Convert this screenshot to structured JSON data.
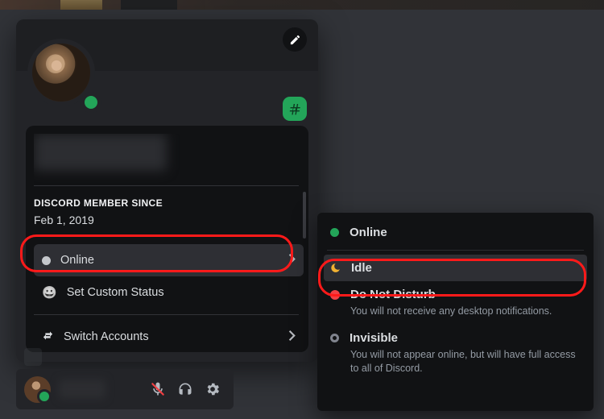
{
  "colors": {
    "accent": "#23a559",
    "danger": "#f23f43",
    "idle": "#f0b132",
    "bg_card": "#232428",
    "bg_panel": "#111214"
  },
  "profile": {
    "member_since_label": "DISCORD MEMBER SINCE",
    "member_since_value": "Feb 1, 2019"
  },
  "menu": {
    "online_label": "Online",
    "set_custom_status_label": "Set Custom Status",
    "switch_accounts_label": "Switch Accounts"
  },
  "status_menu": {
    "online": {
      "label": "Online"
    },
    "idle": {
      "label": "Idle"
    },
    "dnd": {
      "label": "Do Not Disturb",
      "description": "You will not receive any desktop notifications."
    },
    "invisible": {
      "label": "Invisible",
      "description": "You will not appear online, but will have full access to all of Discord."
    }
  }
}
